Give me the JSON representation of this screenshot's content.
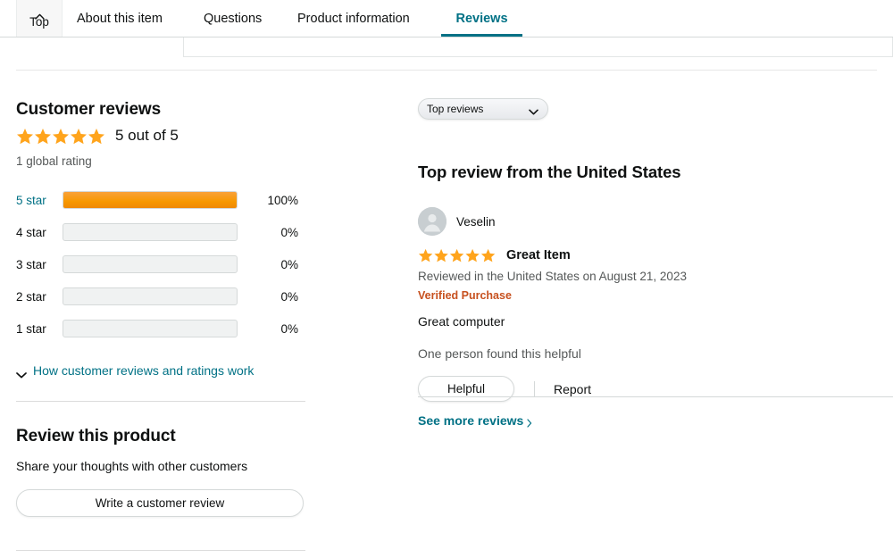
{
  "tabs": [
    {
      "id": "top",
      "label": "Top",
      "icon": "chevron-up-icon",
      "active": false
    },
    {
      "id": "about-this-item",
      "label": "About this item",
      "active": false
    },
    {
      "id": "questions",
      "label": "Questions",
      "active": false
    },
    {
      "id": "product-information",
      "label": "Product information",
      "active": false
    },
    {
      "id": "reviews",
      "label": "Reviews",
      "active": true
    }
  ],
  "customer_reviews": {
    "title": "Customer reviews",
    "stars_filled": 5,
    "rating_text": "5 out of 5",
    "global_rating_text": "1 global rating",
    "histogram": [
      {
        "label": "5 star",
        "percent": 100,
        "percent_label": "100%"
      },
      {
        "label": "4 star",
        "percent": 0,
        "percent_label": "0%"
      },
      {
        "label": "3 star",
        "percent": 0,
        "percent_label": "0%"
      },
      {
        "label": "2 star",
        "percent": 0,
        "percent_label": "0%"
      },
      {
        "label": "1 star",
        "percent": 0,
        "percent_label": "0%"
      }
    ],
    "how_reviews_work_label": "How customer reviews and ratings work",
    "how_reviews_work_icon": "chevron-down-icon"
  },
  "review_this_product": {
    "title": "Review this product",
    "subtitle": "Share your thoughts with other customers",
    "write_review_label": "Write a customer review"
  },
  "reviews_panel": {
    "sort_selected": "Top reviews",
    "sort_icon": "chevron-down-icon",
    "heading": "Top review from the United States",
    "see_more_label": "See more reviews",
    "see_more_icon": "chevron-right-icon"
  },
  "review": {
    "avatar_icon": "user-avatar-icon",
    "author": "Veselin",
    "stars_filled": 5,
    "title": "Great Item",
    "meta": "Reviewed in the United States on August 21, 2023",
    "verified_badge": "Verified Purchase",
    "body": "Great computer",
    "helpful_count_text": "One person found this helpful",
    "helpful_button_label": "Helpful",
    "report_label": "Report"
  },
  "colors": {
    "link_teal": "#007185",
    "star_orange": "#FFA41C",
    "bar_orange": "#F79800",
    "verified_orange": "#C7511F",
    "text_primary": "#0F1111",
    "text_secondary": "#565959",
    "border": "#d5d9d9"
  }
}
